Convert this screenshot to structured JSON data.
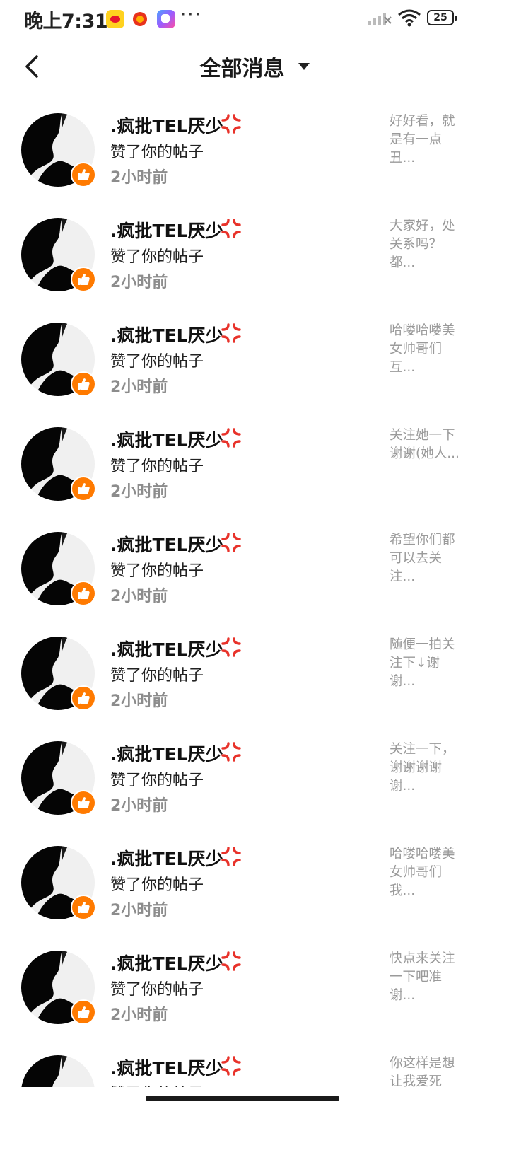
{
  "status_bar": {
    "time": "晚上7:31",
    "more": "···",
    "battery": "25"
  },
  "header": {
    "title": "全部消息"
  },
  "notifications": [
    {
      "name": ".疯批TEL厌少",
      "action": "赞了你的帖子",
      "time": "2小时前",
      "snippet": "好好看，就是有一点丑..."
    },
    {
      "name": ".疯批TEL厌少",
      "action": "赞了你的帖子",
      "time": "2小时前",
      "snippet": "大家好，处关系吗？都..."
    },
    {
      "name": ".疯批TEL厌少",
      "action": "赞了你的帖子",
      "time": "2小时前",
      "snippet": "哈喽哈喽美女帅哥们互..."
    },
    {
      "name": ".疯批TEL厌少",
      "action": "赞了你的帖子",
      "time": "2小时前",
      "snippet": "关注她一下谢谢(她人..."
    },
    {
      "name": ".疯批TEL厌少",
      "action": "赞了你的帖子",
      "time": "2小时前",
      "snippet": "希望你们都可以去关注..."
    },
    {
      "name": ".疯批TEL厌少",
      "action": "赞了你的帖子",
      "time": "2小时前",
      "snippet": "随便一拍关注下↓谢谢..."
    },
    {
      "name": ".疯批TEL厌少",
      "action": "赞了你的帖子",
      "time": "2小时前",
      "snippet": "关注一下，谢谢谢谢谢..."
    },
    {
      "name": ".疯批TEL厌少",
      "action": "赞了你的帖子",
      "time": "2小时前",
      "snippet": "哈喽哈喽美女帅哥们我..."
    },
    {
      "name": ".疯批TEL厌少",
      "action": "赞了你的帖子",
      "time": "2小时前",
      "snippet": "快点来关注一下吧准谢..."
    },
    {
      "name": ".疯批TEL厌少",
      "action": "赞了你的帖子",
      "time": "",
      "snippet": "你这样是想让我爱死"
    }
  ],
  "colors": {
    "like_badge": "#ff7a00",
    "angry_icon": "#e8322a",
    "snippet_text": "#9a9a9a"
  }
}
